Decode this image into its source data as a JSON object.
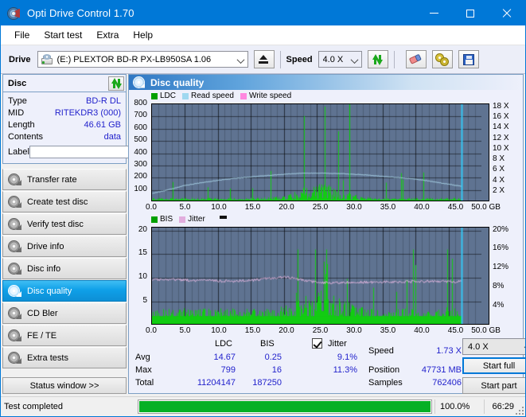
{
  "window": {
    "title": "Opti Drive Control 1.70",
    "icon": "disc-icon",
    "minimize": "minimize",
    "maximize": "maximize",
    "close": "close"
  },
  "menu": {
    "items": [
      "File",
      "Start test",
      "Extra",
      "Help"
    ]
  },
  "toolbar": {
    "drive_label": "Drive",
    "drive_value": "(E:)   PLEXTOR BD-R  PX-LB950SA 1.06",
    "eject_icon": "eject-icon",
    "speed_label": "Speed",
    "speed_value": "4.0 X",
    "refresh_icon": "refresh-icon",
    "erase_icon": "erase-icon",
    "settings_icon": "gear-icon",
    "save_icon": "save-icon"
  },
  "disc": {
    "header": "Disc",
    "refresh_icon": "refresh-icon",
    "rows": [
      {
        "key": "Type",
        "value": "BD-R DL"
      },
      {
        "key": "MID",
        "value": "RITEKDR3 (000)"
      },
      {
        "key": "Length",
        "value": "46.61 GB"
      },
      {
        "key": "Contents",
        "value": "data"
      }
    ],
    "label_key": "Label",
    "label_value": "",
    "label_placeholder": "",
    "cd_icon": "disc-icon"
  },
  "sidebar": {
    "items": [
      {
        "label": "Transfer rate",
        "active": false
      },
      {
        "label": "Create test disc",
        "active": false
      },
      {
        "label": "Verify test disc",
        "active": false
      },
      {
        "label": "Drive info",
        "active": false
      },
      {
        "label": "Disc info",
        "active": false
      },
      {
        "label": "Disc quality",
        "active": true
      },
      {
        "label": "CD Bler",
        "active": false
      },
      {
        "label": "FE / TE",
        "active": false
      },
      {
        "label": "Extra tests",
        "active": false
      }
    ],
    "status_window": "Status window >>"
  },
  "panel": {
    "title": "Disc quality",
    "icon": "disc-icon"
  },
  "chart_data": [
    {
      "type": "line",
      "id": "ldc-chart",
      "title": "",
      "xlabel": "GB",
      "ylabel": "",
      "xlim": [
        0,
        50
      ],
      "ylim": [
        0,
        800
      ],
      "y2lim": [
        0,
        18
      ],
      "grid": true,
      "legend_position": "top-left",
      "legend": [
        {
          "name": "LDC",
          "color": "#00A000"
        },
        {
          "name": "Read speed",
          "color": "#9FD8F0"
        },
        {
          "name": "Write speed",
          "color": "#FF87DF"
        }
      ],
      "xticks": [
        "0.0",
        "5.0",
        "10.0",
        "15.0",
        "20.0",
        "25.0",
        "30.0",
        "35.0",
        "40.0",
        "45.0",
        "50.0 GB"
      ],
      "yticks": [
        "800",
        "700",
        "600",
        "500",
        "400",
        "300",
        "200",
        "100"
      ],
      "y2ticks": [
        "18 X",
        "16 X",
        "14 X",
        "12 X",
        "10 X",
        "8 X",
        "6 X",
        "4 X",
        "2 X"
      ],
      "series": [
        {
          "name": "Read speed",
          "color": "#9FD8F0",
          "axis": "y2",
          "x": [
            0,
            2,
            5,
            8,
            11,
            14,
            17,
            20,
            23,
            26,
            29,
            32,
            35,
            38,
            41,
            44,
            47
          ],
          "values": [
            1.7,
            2.2,
            3.2,
            3.8,
            4.3,
            4.7,
            5.0,
            5.3,
            5.5,
            5.5,
            5.4,
            5.2,
            4.9,
            4.6,
            4.2,
            3.6,
            3.0
          ]
        },
        {
          "name": "LDC",
          "color": "#00C000",
          "axis": "y",
          "note": "dense noisy spikes, baseline ~15, peaks to 799 around 26 GB",
          "baseline": 15,
          "peak": 799,
          "peak_position_gb": 26.3
        }
      ],
      "markers": [
        {
          "name": "green-marker",
          "x": 30.0,
          "color": "#00D000"
        },
        {
          "name": "cursor-line",
          "x": 47.0,
          "color": "#35C6F4"
        }
      ]
    },
    {
      "type": "line",
      "id": "bis-jitter-chart",
      "title": "",
      "xlabel": "GB",
      "ylabel": "",
      "xlim": [
        0,
        50
      ],
      "ylim": [
        0,
        20
      ],
      "y2lim": [
        0,
        20
      ],
      "grid": true,
      "legend_position": "top-left",
      "legend": [
        {
          "name": "BIS",
          "color": "#00A000"
        },
        {
          "name": "Jitter",
          "color": "#E2AEDE"
        }
      ],
      "xticks": [
        "0.0",
        "5.0",
        "10.0",
        "15.0",
        "20.0",
        "25.0",
        "30.0",
        "35.0",
        "40.0",
        "45.0",
        "50.0 GB"
      ],
      "yticks": [
        "20",
        "15",
        "10",
        "5"
      ],
      "y2ticks": [
        "20%",
        "16%",
        "12%",
        "8%",
        "4%"
      ],
      "series": [
        {
          "name": "Jitter",
          "color": "#E2AEDE",
          "axis": "y2",
          "x": [
            0,
            3,
            6,
            9,
            12,
            15,
            18,
            20,
            21,
            23,
            25,
            27,
            30,
            34,
            38,
            42,
            46
          ],
          "values": [
            9.6,
            9.7,
            9.5,
            9.4,
            9.3,
            9.5,
            9.9,
            10.2,
            10.0,
            9.5,
            9.1,
            9.0,
            9.1,
            9.1,
            9.2,
            9.3,
            9.2
          ]
        },
        {
          "name": "BIS",
          "color": "#00C000",
          "axis": "y",
          "note": "dense noisy bars, baseline ~2.5, peaks to 16 near 26 GB",
          "baseline": 2.5,
          "peak": 16,
          "peak_position_gb": 26.3
        }
      ],
      "markers": [
        {
          "name": "cursor-line",
          "x": 47.0,
          "color": "#35C6F4"
        }
      ]
    }
  ],
  "stats": {
    "col_ldc": "LDC",
    "col_bis": "BIS",
    "row_avg": "Avg",
    "row_max": "Max",
    "row_total": "Total",
    "ldc_avg": "14.67",
    "ldc_max": "799",
    "ldc_total": "11204147",
    "bis_avg": "0.25",
    "bis_max": "16",
    "bis_total": "187250",
    "jitter_label": "Jitter",
    "jitter_checked": true,
    "jitter_avg": "9.1%",
    "jitter_max": "11.3%",
    "speed_label": "Speed",
    "speed_value": "1.73 X",
    "position_label": "Position",
    "position_value": "47731 MB",
    "samples_label": "Samples",
    "samples_value": "762406",
    "speed_select": "4.0 X",
    "start_full": "Start full",
    "start_part": "Start part"
  },
  "statusbar": {
    "message": "Test completed",
    "progress_pct": "100.0%",
    "progress_value": 100,
    "elapsed": "66:29"
  },
  "colors": {
    "accent": "#0078d7",
    "panel_bg": "#eef0fb",
    "plot_bg": "#5f7391",
    "ldc_green": "#00C000",
    "read_speed": "#9FD8F0",
    "write_speed": "#FF87DF",
    "jitter_pink": "#E2AEDE",
    "cursor": "#35C6F4",
    "value_text": "#2222cc",
    "progress": "#06b025"
  }
}
